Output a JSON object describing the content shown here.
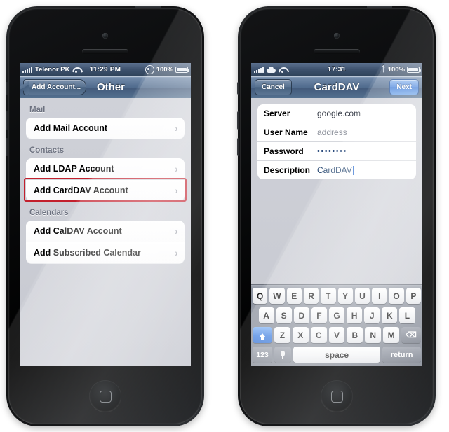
{
  "left_phone": {
    "status_bar": {
      "signal_icon": "signal-bars-icon",
      "carrier": "Telenor PK",
      "wifi_icon": "wifi-icon",
      "time": "11:29 PM",
      "rotation_lock_icon": "rotation-lock-icon",
      "battery_percent": "100%",
      "battery_icon": "battery-full-icon"
    },
    "nav_bar": {
      "back_label": "Add Account...",
      "title": "Other"
    },
    "sections": [
      {
        "header": "Mail",
        "rows": [
          {
            "label": "Add Mail Account",
            "accessory": "chevron-right-icon",
            "highlighted": false
          }
        ]
      },
      {
        "header": "Contacts",
        "rows": [
          {
            "label": "Add LDAP Account",
            "accessory": "chevron-right-icon",
            "highlighted": false
          },
          {
            "label": "Add CardDAV Account",
            "accessory": "chevron-right-icon",
            "highlighted": true
          }
        ]
      },
      {
        "header": "Calendars",
        "rows": [
          {
            "label": "Add CalDAV Account",
            "accessory": "chevron-right-icon",
            "highlighted": false
          },
          {
            "label": "Add Subscribed Calendar",
            "accessory": "chevron-right-icon",
            "highlighted": false
          }
        ]
      }
    ],
    "highlight_color": "#c3202d"
  },
  "right_phone": {
    "status_bar": {
      "signal_icon": "signal-bars-icon",
      "cloud_icon": "cloud-icon",
      "wifi_icon": "wifi-icon",
      "time": "17:31",
      "bluetooth_icon": "bluetooth-icon",
      "battery_percent": "100%",
      "battery_icon": "battery-full-icon"
    },
    "nav_bar": {
      "cancel_label": "Cancel",
      "title": "CardDAV",
      "next_label": "Next",
      "next_color": "#3a78d6"
    },
    "form": [
      {
        "label": "Server",
        "value": "google.com",
        "state": "filled"
      },
      {
        "label": "User Name",
        "value": "address",
        "state": "placeholder"
      },
      {
        "label": "Password",
        "value": "••••••••",
        "state": "secure"
      },
      {
        "label": "Description",
        "value": "CardDAV",
        "state": "editing"
      }
    ],
    "keyboard": {
      "row1": [
        "Q",
        "W",
        "E",
        "R",
        "T",
        "Y",
        "U",
        "I",
        "O",
        "P"
      ],
      "row2": [
        "A",
        "S",
        "D",
        "F",
        "G",
        "H",
        "J",
        "K",
        "L"
      ],
      "row3": [
        "Z",
        "X",
        "C",
        "V",
        "B",
        "N",
        "M"
      ],
      "shift_label": "shift-key",
      "shift_active": true,
      "backspace_label": "backspace-key",
      "numeric_label": "123",
      "mic_label": "dictation-key",
      "space_label": "space",
      "return_label": "return"
    }
  }
}
